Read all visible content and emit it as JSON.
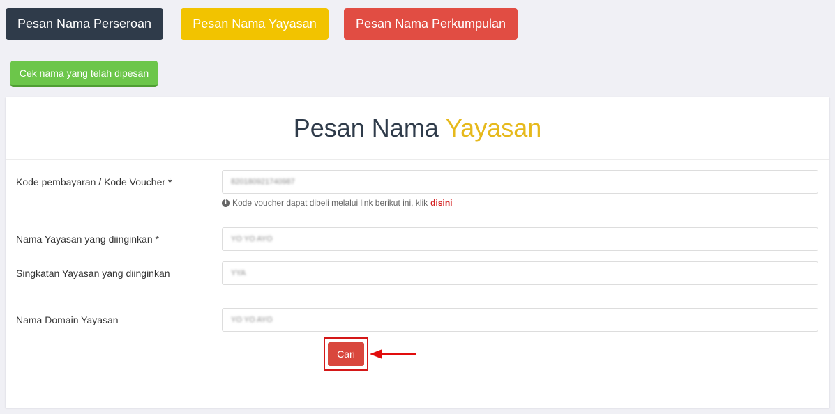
{
  "top_buttons": {
    "perseroan": "Pesan Nama Perseroan",
    "yayasan": "Pesan Nama Yayasan",
    "perkumpulan": "Pesan Nama Perkumpulan"
  },
  "check_button": "Cek nama yang telah dipesan",
  "panel": {
    "title_main": "Pesan Nama",
    "title_accent": "Yayasan"
  },
  "form": {
    "voucher_label": "Kode pembayaran / Kode Voucher *",
    "voucher_value": "820180921740987",
    "voucher_hint": "Kode voucher dapat dibeli melalui link berikut ini, klik",
    "voucher_hint_link": "disini",
    "name_label": "Nama Yayasan yang diinginkan *",
    "name_value": "YO YO AYO",
    "abbr_label": "Singkatan Yayasan yang diinginkan",
    "abbr_value": "YYA",
    "domain_label": "Nama Domain Yayasan",
    "domain_value": "YO YO AYO",
    "search_label": "Cari"
  },
  "colors": {
    "dark": "#2f3b4a",
    "yellow": "#f2c300",
    "red": "#e14d43",
    "green": "#6cc64a",
    "accent": "#e6b91c",
    "highlight": "#d41818"
  },
  "icons": {
    "hint": "info-circle-icon",
    "pointer": "red-arrow-icon"
  }
}
